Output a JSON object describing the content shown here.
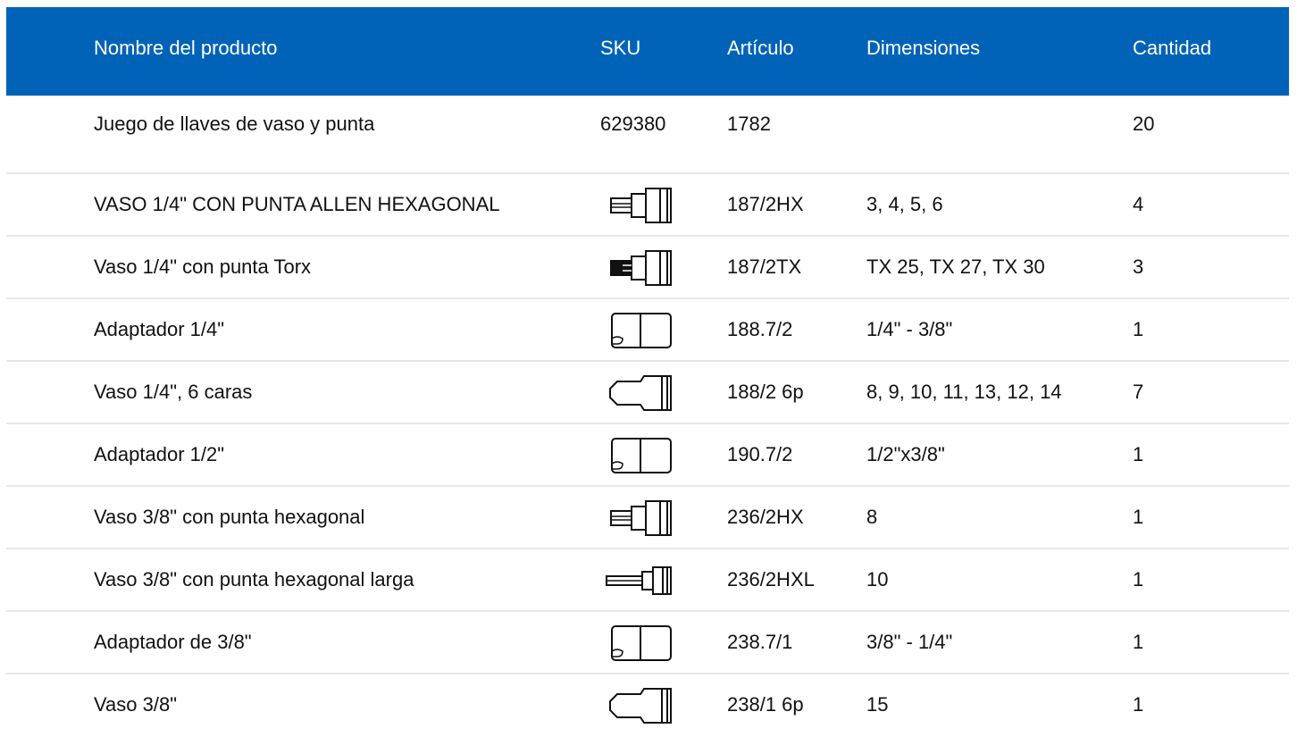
{
  "header": {
    "name": "Nombre del producto",
    "sku": "SKU",
    "article": "Artículo",
    "dimensions": "Dimensiones",
    "quantity": "Cantidad"
  },
  "rows": [
    {
      "name": "Juego de llaves de vaso y punta",
      "sku": "629380",
      "article": "1782",
      "dimensions": "",
      "quantity": "20"
    },
    {
      "name": "VASO 1/4\" CON PUNTA ALLEN HEXAGONAL",
      "icon": "hex-bit-socket-icon",
      "article": "187/2HX",
      "dimensions": "3, 4, 5, 6",
      "quantity": "4"
    },
    {
      "name": "Vaso 1/4\" con punta Torx",
      "icon": "torx-bit-socket-icon",
      "article": "187/2TX",
      "dimensions": "TX 25, TX 27, TX 30",
      "quantity": "3"
    },
    {
      "name": "Adaptador 1/4\"",
      "icon": "adapter-icon",
      "article": "188.7/2",
      "dimensions": "1/4\" - 3/8\"",
      "quantity": "1"
    },
    {
      "name": "Vaso 1/4\", 6 caras",
      "icon": "socket-icon",
      "article": "188/2 6p",
      "dimensions": "8, 9, 10, 11, 13, 12, 14",
      "quantity": "7"
    },
    {
      "name": "Adaptador 1/2\"",
      "icon": "adapter-icon",
      "article": "190.7/2",
      "dimensions": "1/2\"x3/8\"",
      "quantity": "1"
    },
    {
      "name": "Vaso 3/8\" con punta hexagonal",
      "icon": "hex-bit-socket-icon",
      "article": "236/2HX",
      "dimensions": "8",
      "quantity": "1"
    },
    {
      "name": "Vaso 3/8\" con punta hexagonal larga",
      "icon": "long-hex-bit-socket-icon",
      "article": "236/2HXL",
      "dimensions": "10",
      "quantity": "1"
    },
    {
      "name": "Adaptador de 3/8\"",
      "icon": "adapter-icon",
      "article": "238.7/1",
      "dimensions": "3/8\" - 1/4\"",
      "quantity": "1"
    },
    {
      "name": "Vaso 3/8\"",
      "icon": "socket-icon",
      "article": "238/1 6p",
      "dimensions": "15",
      "quantity": "1"
    }
  ]
}
